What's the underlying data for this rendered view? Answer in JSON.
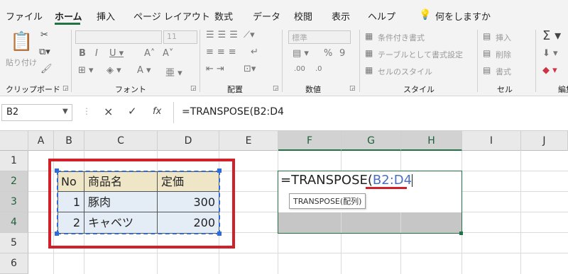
{
  "ribbon": {
    "tabs": [
      "ファイル",
      "ホーム",
      "挿入",
      "ページ レイアウト",
      "数式",
      "データ",
      "校閲",
      "表示",
      "ヘルプ"
    ],
    "tell_me": "何をしますか",
    "groups": [
      "クリップボード",
      "フォント",
      "配置",
      "数値",
      "スタイル",
      "セル",
      "編集"
    ],
    "paste_label": "貼り付け",
    "font_size": "11",
    "number_format": "標準",
    "styles": [
      "条件付き書式",
      "テーブルとして書式設定",
      "セルのスタイル"
    ],
    "cells": [
      "挿入",
      "削除",
      "書式"
    ]
  },
  "formula_bar": {
    "name_box": "B2",
    "cancel": "×",
    "enter": "✓",
    "fx": "fx",
    "formula": "=TRANSPOSE(B2:D4"
  },
  "grid": {
    "columns": [
      "A",
      "B",
      "C",
      "D",
      "E",
      "F",
      "G",
      "H",
      "I",
      "J"
    ],
    "rows": [
      "1",
      "2",
      "3",
      "4",
      "5",
      "6"
    ],
    "table_header": [
      "No",
      "商品名",
      "定価"
    ],
    "table_rows": [
      [
        "1",
        "豚肉",
        "300"
      ],
      [
        "2",
        "キャベツ",
        "200"
      ]
    ],
    "edit_cell": {
      "prefix": "=TRANSPOSE(",
      "ref": "B2:D4",
      "tooltip": "TRANSPOSE(配列)"
    }
  },
  "colors": {
    "accent": "#217346",
    "highlight_box": "#d0202a",
    "ref_blue": "#4a6fc0"
  }
}
